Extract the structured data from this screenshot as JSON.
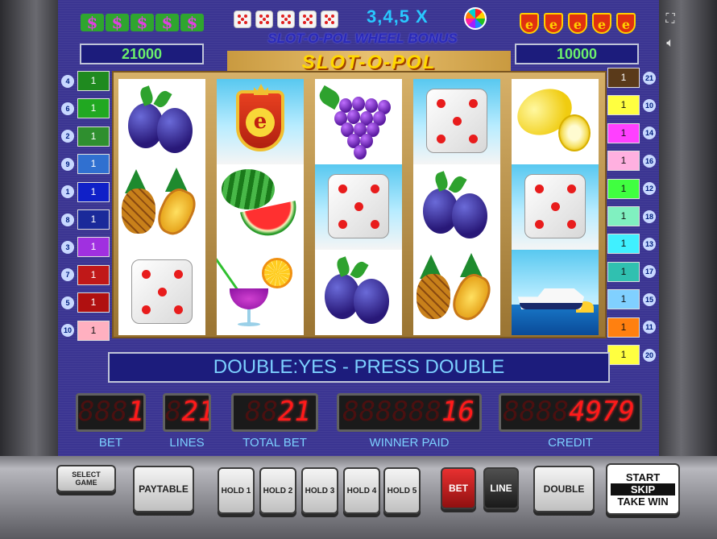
{
  "bonus": {
    "multiplier": "3,4,5 X",
    "title": "SLOT-O-POL WHEEL BONUS"
  },
  "jackpots": {
    "left": "21000",
    "right": "10000"
  },
  "game_title": "SLOT-O-POL",
  "left_lines": [
    {
      "num": "4",
      "bet": "1",
      "color": "#1f8a1f"
    },
    {
      "num": "6",
      "bet": "1",
      "color": "#21a821"
    },
    {
      "num": "2",
      "bet": "1",
      "color": "#2f8f2f"
    },
    {
      "num": "9",
      "bet": "1",
      "color": "#3070d0"
    },
    {
      "num": "1",
      "bet": "1",
      "color": "#1020c8"
    },
    {
      "num": "8",
      "bet": "1",
      "color": "#1a2a9a"
    },
    {
      "num": "3",
      "bet": "1",
      "color": "#a030e0"
    },
    {
      "num": "7",
      "bet": "1",
      "color": "#c01818"
    },
    {
      "num": "5",
      "bet": "1",
      "color": "#b01010"
    },
    {
      "num": "10",
      "bet": "1",
      "color": "#ffb0c0"
    }
  ],
  "right_lines": [
    {
      "num": "21",
      "bet": "1",
      "color": "#5a3a1a"
    },
    {
      "num": "10",
      "bet": "1",
      "color": "#ffff40"
    },
    {
      "num": "14",
      "bet": "1",
      "color": "#ff40ff"
    },
    {
      "num": "16",
      "bet": "1",
      "color": "#ffb0e0"
    },
    {
      "num": "12",
      "bet": "1",
      "color": "#40ff40"
    },
    {
      "num": "18",
      "bet": "1",
      "color": "#80f0c0"
    },
    {
      "num": "13",
      "bet": "1",
      "color": "#40f0ff"
    },
    {
      "num": "17",
      "bet": "1",
      "color": "#30c0b0"
    },
    {
      "num": "15",
      "bet": "1",
      "color": "#80d0ff"
    },
    {
      "num": "11",
      "bet": "1",
      "color": "#ff8010"
    },
    {
      "num": "20",
      "bet": "1",
      "color": "#ffff40"
    }
  ],
  "reels": [
    [
      "plum",
      "pineapple",
      "dice"
    ],
    [
      "shield",
      "watermelon",
      "cocktail"
    ],
    [
      "grapes",
      "dice",
      "plum"
    ],
    [
      "dice",
      "plum",
      "pineapple"
    ],
    [
      "lemon",
      "dice",
      "yacht"
    ]
  ],
  "message": "DOUBLE:YES - PRESS DOUBLE",
  "counters": {
    "bet": {
      "value": "1",
      "ghost": "888",
      "label": "BET"
    },
    "lines": {
      "value": "21",
      "ghost": "8",
      "label": "LINES"
    },
    "total_bet": {
      "value": "21",
      "ghost": "88",
      "label": "TOTAL BET"
    },
    "winner_paid": {
      "value": "16",
      "ghost": "888888",
      "label": "WINNER PAID"
    },
    "credit": {
      "value": "4979",
      "ghost": "8888",
      "label": "CREDIT"
    }
  },
  "buttons": {
    "select_game": "SELECT GAME",
    "paytable": "PAYTABLE",
    "hold1": "HOLD 1",
    "hold2": "HOLD 2",
    "hold3": "HOLD 3",
    "hold4": "HOLD 4",
    "hold5": "HOLD 5",
    "bet": "BET",
    "line": "LINE",
    "double": "DOUBLE",
    "start": "START",
    "skip": "SKIP",
    "take_win": "TAKE WIN"
  },
  "colors": {
    "screen_bg": "#3b3592",
    "counter_digit": "#ff1a1a",
    "label_text": "#7cd0ff",
    "jackpot_text": "#6cf06c"
  }
}
